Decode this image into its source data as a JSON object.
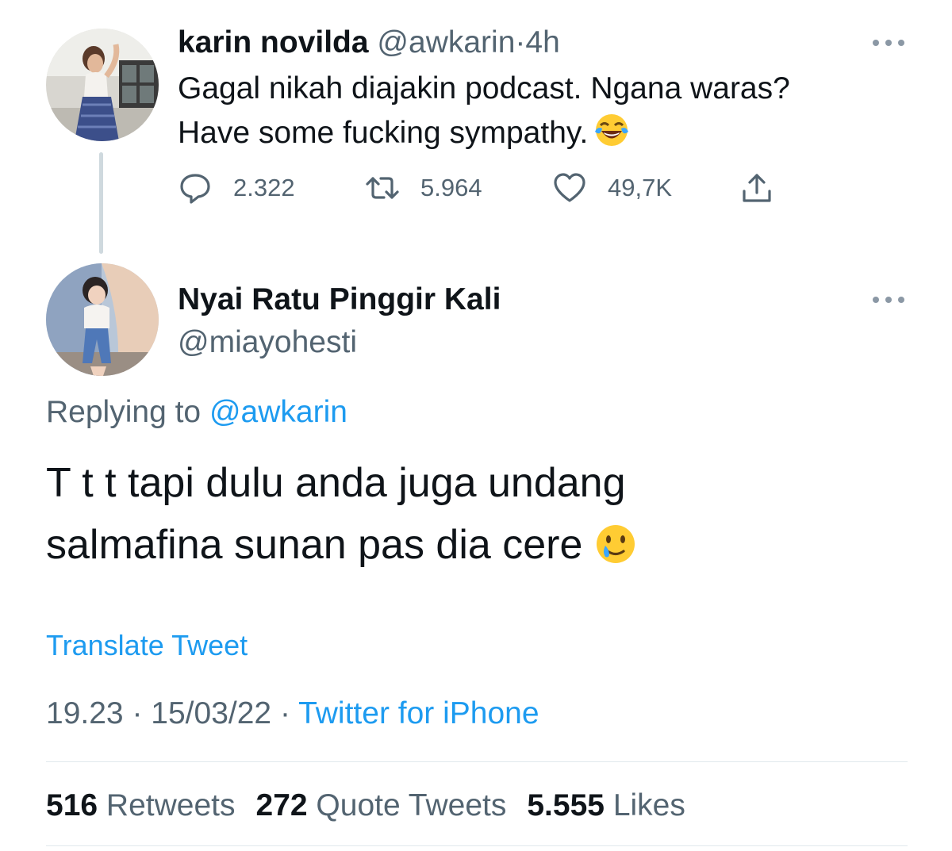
{
  "parent_tweet": {
    "author_name": "karin novilda",
    "author_handle": "@awkarin",
    "separator": "·",
    "time": "4h",
    "text_line1": "Gagal nikah diajakin podcast. Ngana waras?",
    "text_line2": "Have some fucking sympathy.",
    "emoji": "face-with-tears-of-joy",
    "replies": "2.322",
    "retweets": "5.964",
    "likes": "49,7K"
  },
  "reply_tweet": {
    "author_name": "Nyai Ratu Pinggir Kali",
    "author_handle": "@miayohesti",
    "replying_prefix": "Replying to",
    "replying_to": "@awkarin",
    "text_line1": "T t t tapi dulu anda juga undang",
    "text_line2": "salmafina sunan pas dia cere",
    "emoji": "smiling-face-with-tear",
    "translate_label": "Translate Tweet",
    "time": "19.23",
    "separator": "·",
    "date": "15/03/22",
    "source": "Twitter for iPhone"
  },
  "stats": {
    "retweets_count": "516",
    "retweets_label": "Retweets",
    "quotes_count": "272",
    "quotes_label": "Quote Tweets",
    "likes_count": "5.555",
    "likes_label": "Likes"
  },
  "colors": {
    "text": "#0f1419",
    "muted": "#536471",
    "link": "#1d9bf0",
    "line": "#cfd9de"
  }
}
